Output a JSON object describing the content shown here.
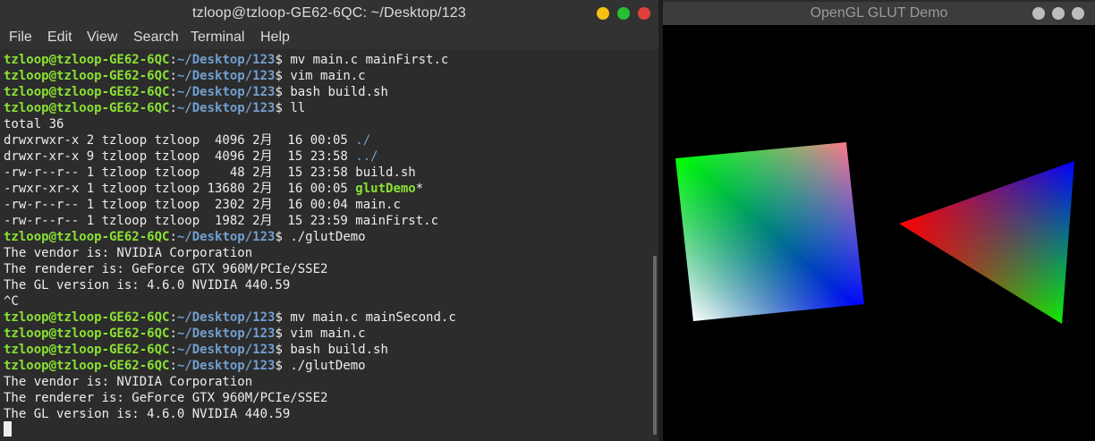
{
  "terminal": {
    "title": "tzloop@tzloop-GE62-6QC: ~/Desktop/123",
    "menu": [
      "File",
      "Edit",
      "View",
      "Search",
      "Terminal",
      "Help"
    ],
    "prompt_user": "tzloop@tzloop-GE62-6QC",
    "prompt_colon": ":",
    "prompt_path": "~/Desktop/123",
    "prompt_symbol": "$ ",
    "lines": [
      {
        "type": "cmd",
        "text": "mv main.c mainFirst.c"
      },
      {
        "type": "cmd",
        "text": "vim main.c"
      },
      {
        "type": "cmd",
        "text": "bash build.sh"
      },
      {
        "type": "cmd",
        "text": "ll"
      },
      {
        "type": "out",
        "text": "total 36"
      },
      {
        "type": "ls",
        "prefix": "drwxrwxr-x 2 tzloop tzloop  4096 2月  16 00:05 ",
        "name": "./",
        "kind": "dir"
      },
      {
        "type": "ls",
        "prefix": "drwxr-xr-x 9 tzloop tzloop  4096 2月  15 23:58 ",
        "name": "../",
        "kind": "dir"
      },
      {
        "type": "ls",
        "prefix": "-rw-r--r-- 1 tzloop tzloop    48 2月  15 23:58 ",
        "name": "build.sh",
        "kind": "file"
      },
      {
        "type": "ls",
        "prefix": "-rwxr-xr-x 1 tzloop tzloop 13680 2月  16 00:05 ",
        "name": "glutDemo",
        "suffix": "*",
        "kind": "exe"
      },
      {
        "type": "ls",
        "prefix": "-rw-r--r-- 1 tzloop tzloop  2302 2月  16 00:04 ",
        "name": "main.c",
        "kind": "file"
      },
      {
        "type": "ls",
        "prefix": "-rw-r--r-- 1 tzloop tzloop  1982 2月  15 23:59 ",
        "name": "mainFirst.c",
        "kind": "file"
      },
      {
        "type": "cmd",
        "text": "./glutDemo"
      },
      {
        "type": "out",
        "text": "The vendor is: NVIDIA Corporation"
      },
      {
        "type": "out",
        "text": "The renderer is: GeForce GTX 960M/PCIe/SSE2"
      },
      {
        "type": "out",
        "text": "The GL version is: 4.6.0 NVIDIA 440.59"
      },
      {
        "type": "out",
        "text": "^C"
      },
      {
        "type": "cmd",
        "text": "mv main.c mainSecond.c"
      },
      {
        "type": "cmd",
        "text": "vim main.c"
      },
      {
        "type": "cmd",
        "text": "bash build.sh"
      },
      {
        "type": "cmd",
        "text": "./glutDemo"
      },
      {
        "type": "out",
        "text": "The vendor is: NVIDIA Corporation"
      },
      {
        "type": "out",
        "text": "The renderer is: GeForce GTX 960M/PCIe/SSE2"
      },
      {
        "type": "out",
        "text": "The GL version is: 4.6.0 NVIDIA 440.59"
      }
    ]
  },
  "gl_window": {
    "title": "OpenGL GLUT Demo"
  },
  "colors": {
    "window_min": "#f5c211",
    "window_max": "#26c032",
    "window_close": "#e0413a",
    "prompt_green": "#8ae234",
    "prompt_blue": "#729fcf"
  }
}
